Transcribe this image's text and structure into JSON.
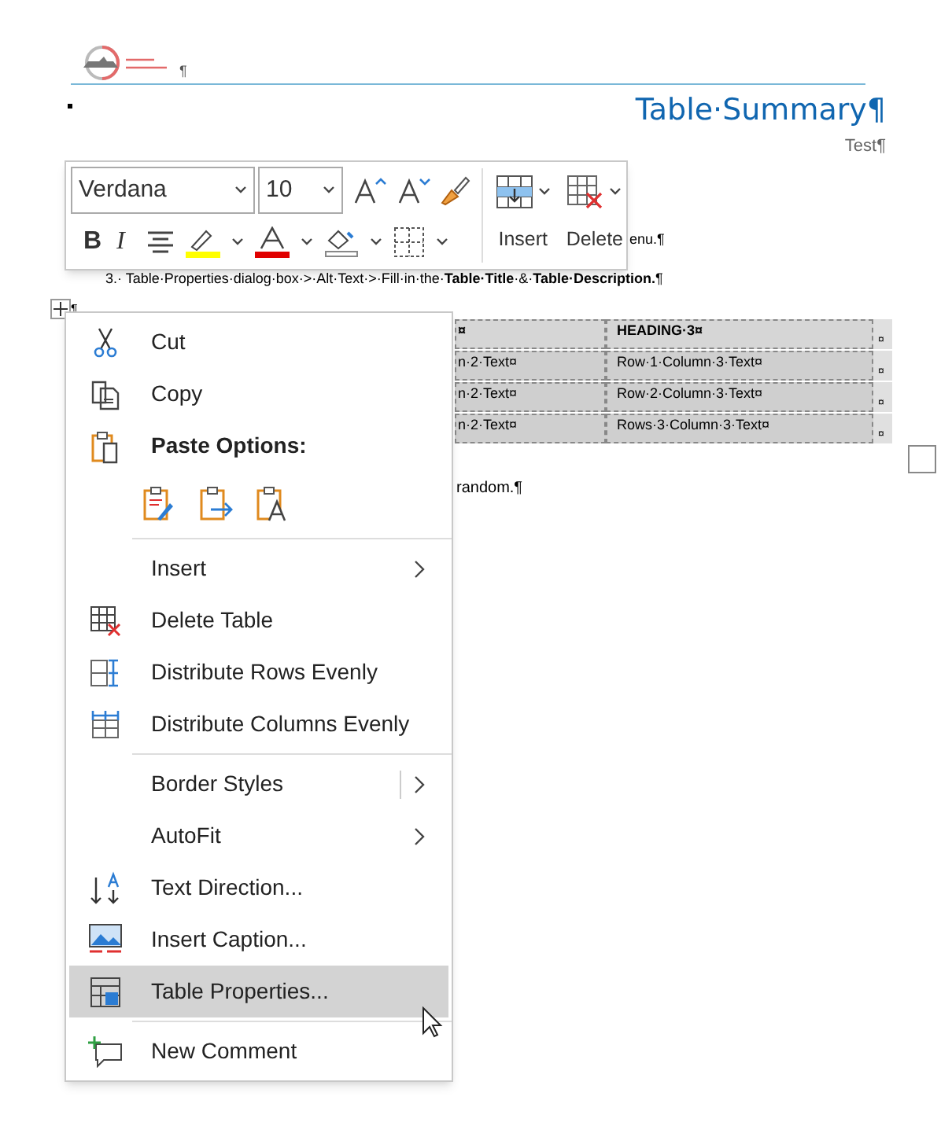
{
  "header": {
    "pilcrow": "¶"
  },
  "title": "Table·Summary¶",
  "subtitle": "Test¶",
  "body": {
    "line_1": "enu.¶",
    "line_2": "3.· Table·Properties·dialog·box·>·Alt·Text·>·Fill·in·the·**Table·Title**·&·**Table·Description.**¶",
    "anchor_mark": "¶",
    "after_table": "random.¶"
  },
  "table": {
    "rows": [
      {
        "header": true,
        "cells": [
          "¤",
          "HEADING·3¤"
        ],
        "end": "¤"
      },
      {
        "header": false,
        "cells": [
          "n·2·Text¤",
          "Row·1·Column·3·Text¤"
        ],
        "end": "¤"
      },
      {
        "header": false,
        "cells": [
          "n·2·Text¤",
          "Row·2·Column·3·Text¤"
        ],
        "end": "¤"
      },
      {
        "header": false,
        "cells": [
          "n·2·Text¤",
          "Rows·3·Column·3·Text¤"
        ],
        "end": "¤"
      }
    ]
  },
  "toolbar": {
    "font": "Verdana",
    "size": "10",
    "bold": "B",
    "italic": "I",
    "insert": "Insert",
    "delete": "Delete"
  },
  "menu": {
    "items": [
      {
        "kind": "item",
        "label": "Cut",
        "selected": false
      },
      {
        "kind": "item",
        "label": "Copy",
        "selected": false
      },
      {
        "kind": "heading",
        "label": "Paste Options:"
      },
      {
        "kind": "paste-row"
      },
      {
        "kind": "separator"
      },
      {
        "kind": "submenu",
        "label": "Insert",
        "selected": false
      },
      {
        "kind": "item",
        "label": "Delete Table",
        "selected": false
      },
      {
        "kind": "item",
        "label": "Distribute Rows Evenly",
        "selected": false
      },
      {
        "kind": "item",
        "label": "Distribute Columns Evenly",
        "selected": false
      },
      {
        "kind": "separator"
      },
      {
        "kind": "split-submenu",
        "label": "Border Styles",
        "selected": false
      },
      {
        "kind": "submenu",
        "label": "AutoFit",
        "selected": false
      },
      {
        "kind": "item",
        "label": "Text Direction...",
        "selected": false
      },
      {
        "kind": "item",
        "label": "Insert Caption...",
        "selected": false
      },
      {
        "kind": "item",
        "label": "Table Properties...",
        "selected": true
      },
      {
        "kind": "separator"
      },
      {
        "kind": "item",
        "label": "New Comment",
        "selected": false
      }
    ]
  }
}
